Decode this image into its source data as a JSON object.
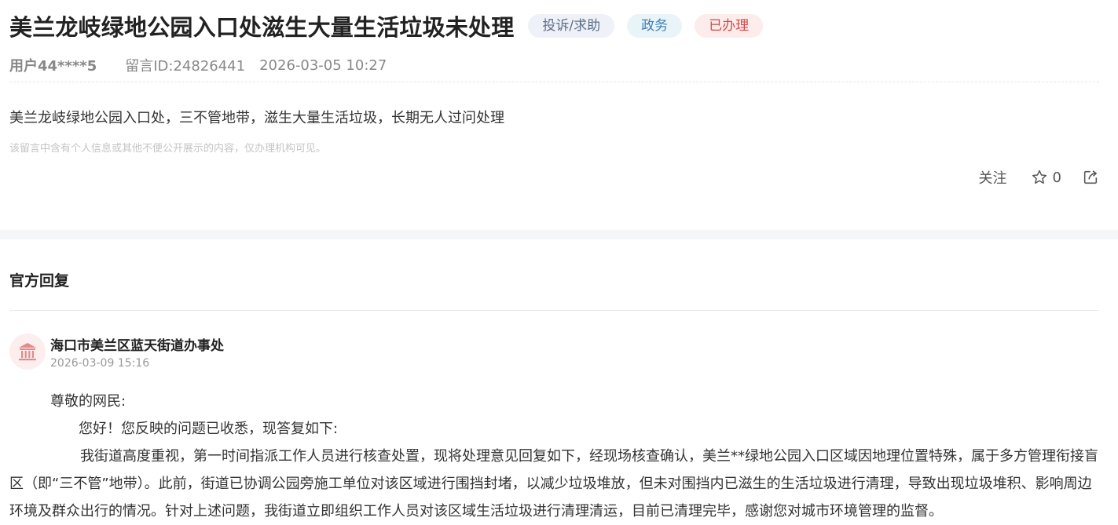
{
  "post": {
    "title": "美兰龙岐绿地公园入口处滋生大量生活垃圾未处理",
    "tags": {
      "type": "投诉/求助",
      "dept": "政务",
      "status": "已办理"
    },
    "user": "用户44****5",
    "message_id": "留言ID:24826441",
    "datetime": "2026-03-05 10:27",
    "content": "美兰龙岐绿地公园入口处，三不管地带，滋生大量生活垃圾，长期无人过问处理",
    "privacy_notice": "该留言中含有个人信息或其他不便公开展示的内容，仅办理机构可见。",
    "actions": {
      "follow_label": "关注",
      "star_count": "0"
    }
  },
  "reply": {
    "heading": "官方回复",
    "org_name": "海口市美兰区蓝天街道办事处",
    "datetime": "2026-03-09 15:16",
    "salutation": "尊敬的网民:",
    "greeting": "您好！您反映的问题已收悉，现答复如下:",
    "body": "我街道高度重视，第一时间指派工作人员进行核查处置，现将处理意见回复如下，经现场核查确认，美兰**绿地公园入口区域因地理位置特殊，属于多方管理衔接盲区（即“三不管”地带）。此前，街道已协调公园旁施工单位对该区域进行围挡封堵，以减少垃圾堆放，但未对围挡内已滋生的生活垃圾进行清理，导致出现垃圾堆积、影响周边环境及群众出行的情况。针对上述问题，我街道立即组织工作人员对该区域生活垃圾进行清理清运，目前已清理完毕，感谢您对城市环境管理的监督。"
  },
  "colors": {
    "tag_type_bg": "#eef1f7",
    "tag_dept_bg": "#e9f4f8",
    "tag_status_bg": "#fdecec",
    "status_text": "#d44848",
    "avatar_bg": "#fdeeee",
    "avatar_icon": "#e38a8a"
  },
  "icons": {
    "star": "star-icon",
    "share": "share-icon",
    "avatar": "government-building-icon"
  }
}
